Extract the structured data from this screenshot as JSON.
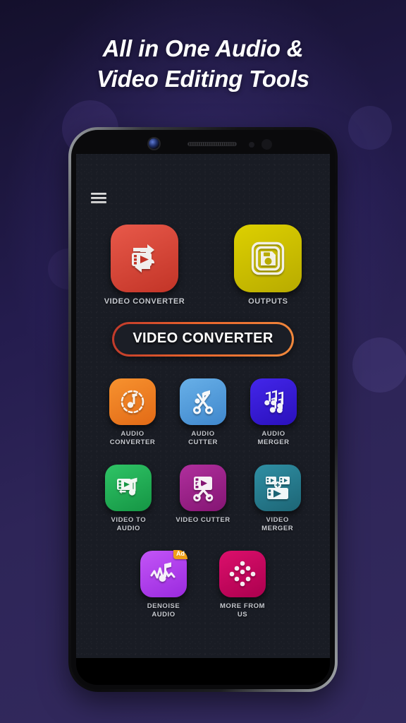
{
  "page": {
    "background_color": "#241c4e",
    "accent_color": "#e8642c"
  },
  "headline": {
    "line1": "All in One Audio &",
    "line2": "Video Editing Tools"
  },
  "phone": {
    "bezel_color": "#0b0b0d",
    "screen_bg": "#191c24",
    "hardware": {
      "front_camera": "front-camera",
      "earpiece": "earpiece-speaker",
      "proximity_sensor": "proximity-sensor"
    }
  },
  "app": {
    "menu_icon": "hamburger-menu-icon",
    "cta_button": {
      "label": "VIDEO CONVERTER",
      "border_gradient_from": "#c0392b",
      "border_gradient_to": "#f0883c"
    },
    "top_row": [
      {
        "id": "video-converter",
        "label": "VIDEO CONVERTER",
        "icon": "video-converter-icon",
        "color": "#d94436"
      },
      {
        "id": "outputs",
        "label": "OUTPUTS",
        "icon": "floppy-disk-save-icon",
        "color": "#cdc000"
      }
    ],
    "rows": [
      [
        {
          "id": "audio-converter",
          "label": "AUDIO\nCONVERTER",
          "icon": "audio-converter-note-icon",
          "color": "#f07c22"
        },
        {
          "id": "audio-cutter",
          "label": "AUDIO\nCUTTER",
          "icon": "audio-cutter-scissors-icon",
          "color": "#4f9ede"
        },
        {
          "id": "audio-merger",
          "label": "AUDIO\nMERGER",
          "icon": "audio-merger-notes-icon",
          "color": "#3418d8"
        }
      ],
      [
        {
          "id": "video-to-audio",
          "label": "VIDEO TO\nAUDIO",
          "icon": "video-to-audio-icon",
          "color": "#1faa52"
        },
        {
          "id": "video-cutter",
          "label": "VIDEO CUTTER",
          "icon": "video-cutter-scissors-icon",
          "color": "#9c1b87"
        },
        {
          "id": "video-merger",
          "label": "VIDEO\nMERGER",
          "icon": "video-merger-icon",
          "color": "#26798c"
        }
      ],
      [
        {
          "id": "denoise-audio",
          "label": "DENOISE\nAUDIO",
          "icon": "denoise-audio-waveform-icon",
          "color": "#b23ef0",
          "badge": "Ad"
        },
        {
          "id": "more-from-us",
          "label": "MORE FROM\nUS",
          "icon": "more-apps-dots-icon",
          "color": "#c6005c"
        }
      ]
    ]
  }
}
